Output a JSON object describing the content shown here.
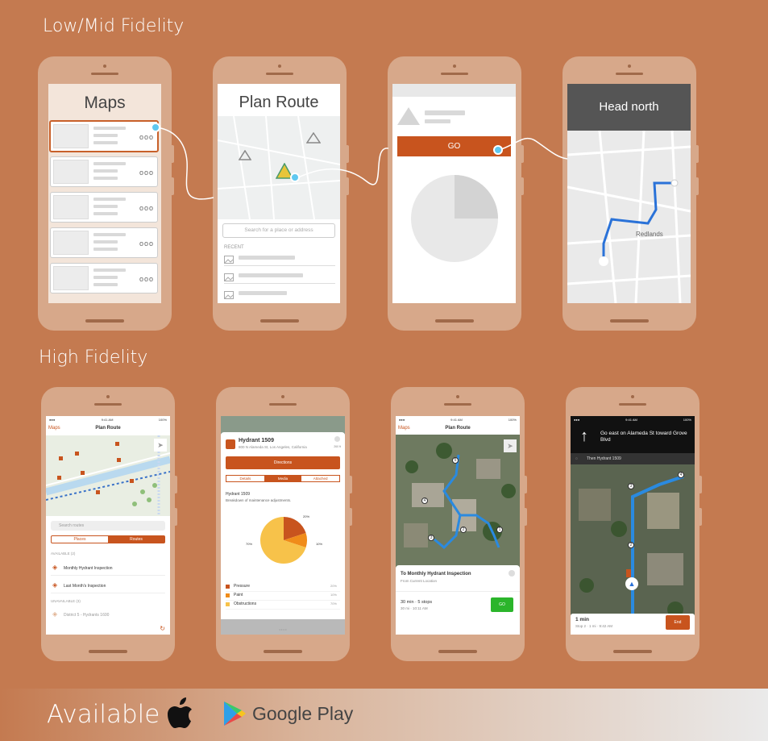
{
  "sections": {
    "low": "Low/Mid Fidelity",
    "high": "High Fidelity"
  },
  "lf1": {
    "title": "Maps",
    "more": "ooo"
  },
  "lf2": {
    "title": "Plan Route",
    "search": "Search for a place or address",
    "recent": "RECENT"
  },
  "lf3": {
    "go": "GO"
  },
  "lf4": {
    "title": "Head north",
    "place": "Redlands"
  },
  "hf1": {
    "time": "9:41 AM",
    "battery": "100%",
    "back": "Maps",
    "title": "Plan Route",
    "search": "Search routes",
    "seg": [
      "Places",
      "Routes"
    ],
    "available": "AVAILABLE (2)",
    "items": [
      "Monthly Hydrant Inspection",
      "Last Month's Inspection"
    ],
    "unavailable": "UNAVAILABLE (3)",
    "disabled": "District 5 - Hydrants 1600"
  },
  "hf2": {
    "name": "Hydrant 1509",
    "addr": "800 N Alameda St, Los Angeles, California",
    "dist": "260 ft",
    "btn": "Directions",
    "tabs": [
      "Details",
      "Media",
      "Attached"
    ],
    "sub": "Hydrant 1509",
    "desc": "Breakdown of maintenance adjustments.",
    "pie": {
      "type": "pie",
      "values": [
        20,
        10,
        70
      ],
      "labels": [
        "Pressure",
        "Paint",
        "Obstructions"
      ],
      "colors": [
        "#c8541e",
        "#f08c1a",
        "#f7c24a"
      ],
      "pct": [
        "20%",
        "10%",
        "70%"
      ]
    },
    "pager": "• • • •"
  },
  "hf3": {
    "time": "9:41 AM",
    "battery": "100%",
    "back": "Maps",
    "title": "Plan Route",
    "card_title": "To Monthly Hydrant Inspection",
    "card_sub": "From Current Location",
    "eta": "30 min · 5 stops",
    "eta_sub": "30 mi · 10:11 AM",
    "go": "GO",
    "stops": [
      "1",
      "2",
      "3",
      "4",
      "5"
    ]
  },
  "hf4": {
    "time": "9:41 AM",
    "battery": "100%",
    "instr": "Go east on Alameda St toward Grove Blvd",
    "then": "Then Hydrant 1509",
    "stops": [
      "2",
      "3",
      "4"
    ],
    "eta": "1 min",
    "eta_sub": "Stop 2 · 1 mi · 9:42 AM",
    "end": "End"
  },
  "footer": {
    "available": "Available",
    "gplay": "Google Play"
  }
}
